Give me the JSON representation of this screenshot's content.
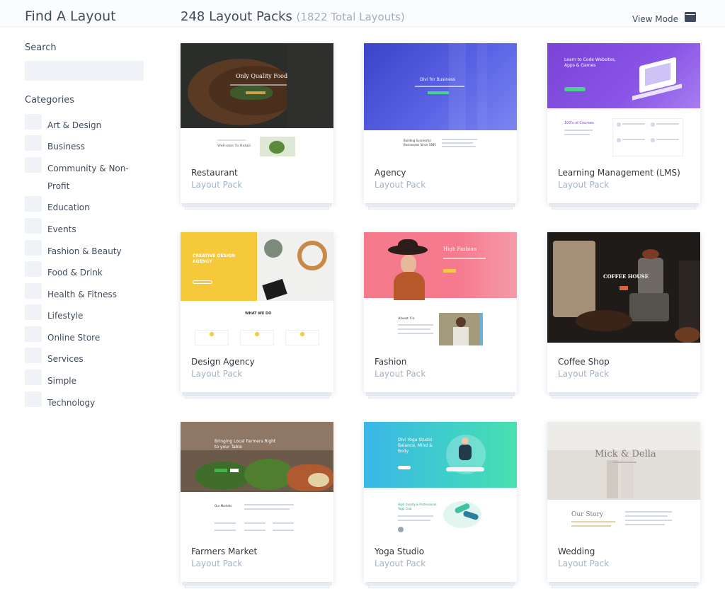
{
  "sidebar": {
    "title": "Find A Layout",
    "search_label": "Search",
    "search_placeholder": "",
    "categories_label": "Categories",
    "categories": [
      "Art & Design",
      "Business",
      "Community & Non-Profit",
      "Education",
      "Events",
      "Fashion & Beauty",
      "Food & Drink",
      "Health & Fitness",
      "Lifestyle",
      "Online Store",
      "Services",
      "Simple",
      "Technology"
    ]
  },
  "header": {
    "count": "248 Layout Packs",
    "total": "(1822 Total Layouts)",
    "view_mode": "View Mode",
    "view_mode_icon": "grid-icon"
  },
  "cards": [
    {
      "name": "Restaurant",
      "sub": "Layout Pack"
    },
    {
      "name": "Agency",
      "sub": "Layout Pack"
    },
    {
      "name": "Learning Management (LMS)",
      "sub": "Layout Pack"
    },
    {
      "name": "Design Agency",
      "sub": "Layout Pack"
    },
    {
      "name": "Fashion",
      "sub": "Layout Pack"
    },
    {
      "name": "Coffee Shop",
      "sub": "Layout Pack"
    },
    {
      "name": "Farmers Market",
      "sub": "Layout Pack"
    },
    {
      "name": "Yoga Studio",
      "sub": "Layout Pack"
    },
    {
      "name": "Wedding",
      "sub": "Layout Pack"
    }
  ],
  "previews": {
    "restaurant": {
      "hero": "Only Quality Food",
      "section": "Welcome To Retail"
    },
    "agency": {
      "hero": "Divi for Business",
      "section": "Building Successful Businesses Since 1985"
    },
    "lms": {
      "hero": "Learn to Code Websites, Apps & Games",
      "courses": "100's of Courses"
    },
    "design_agency": {
      "hero": "CREATIVE DESIGN AGENCY",
      "section": "WHAT WE DO"
    },
    "fashion": {
      "hero": "High Fashion",
      "section": "About Us"
    },
    "coffee": {
      "hero": "COFFEE HOUSE"
    },
    "farmers": {
      "hero": "Bringing Local Farmers Right to your Table",
      "section": "Our Markets"
    },
    "yoga": {
      "hero": "Divi Yoga Studio Balance, Mind & Body",
      "section": "High Quality & Professional Yoga Club"
    },
    "wedding": {
      "hero": "Mick & Della",
      "section": "Our Story"
    }
  },
  "colors": {
    "accent_text": "#3e4b5b",
    "muted_text": "#a3b3c6",
    "input_bg": "#eff2f6"
  }
}
